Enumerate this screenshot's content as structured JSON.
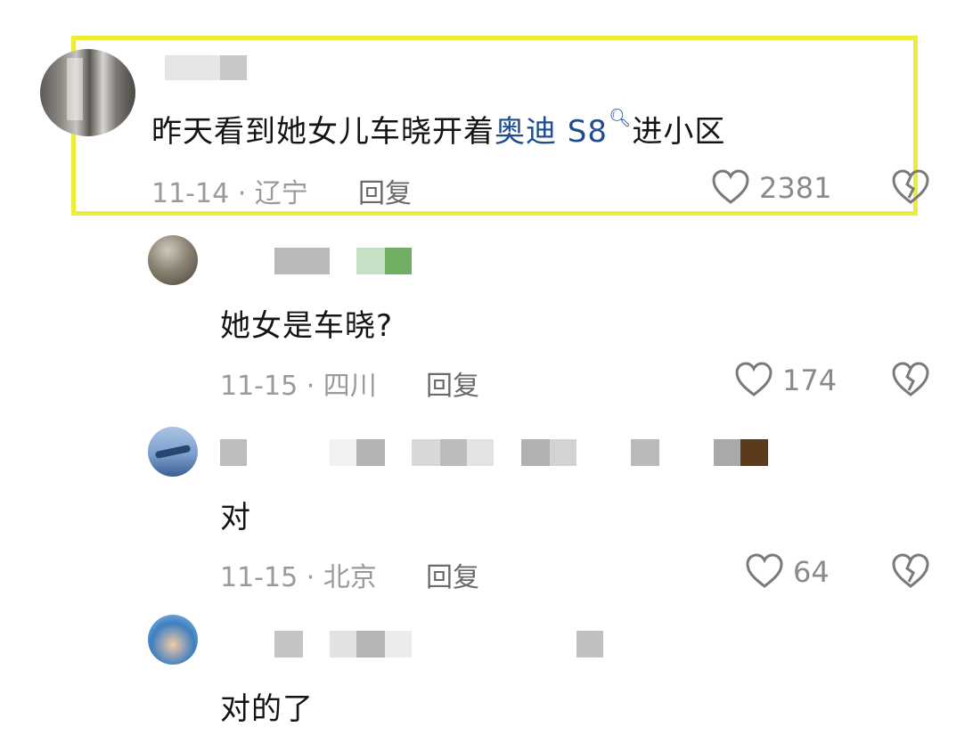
{
  "comments": [
    {
      "text_before": "昨天看到她女儿车晓开着",
      "link_text": "奥迪 S8",
      "search_icon": "search-icon",
      "text_after": "进小区",
      "date_location": "11-14 · 辽宁",
      "reply_label": "回复",
      "likes": "2381"
    },
    {
      "text": "她女是车晓?",
      "date_location": "11-15 · 四川",
      "reply_label": "回复",
      "likes": "174"
    },
    {
      "text": "对",
      "date_location": "11-15 · 北京",
      "reply_label": "回复",
      "likes": "64"
    },
    {
      "text": "对的了"
    }
  ],
  "colors": {
    "highlight": "#ecec3a",
    "link": "#1f4d8f",
    "meta": "#9a9a9a"
  },
  "icons": {
    "like": "heart-icon",
    "dislike": "broken-heart-icon"
  }
}
